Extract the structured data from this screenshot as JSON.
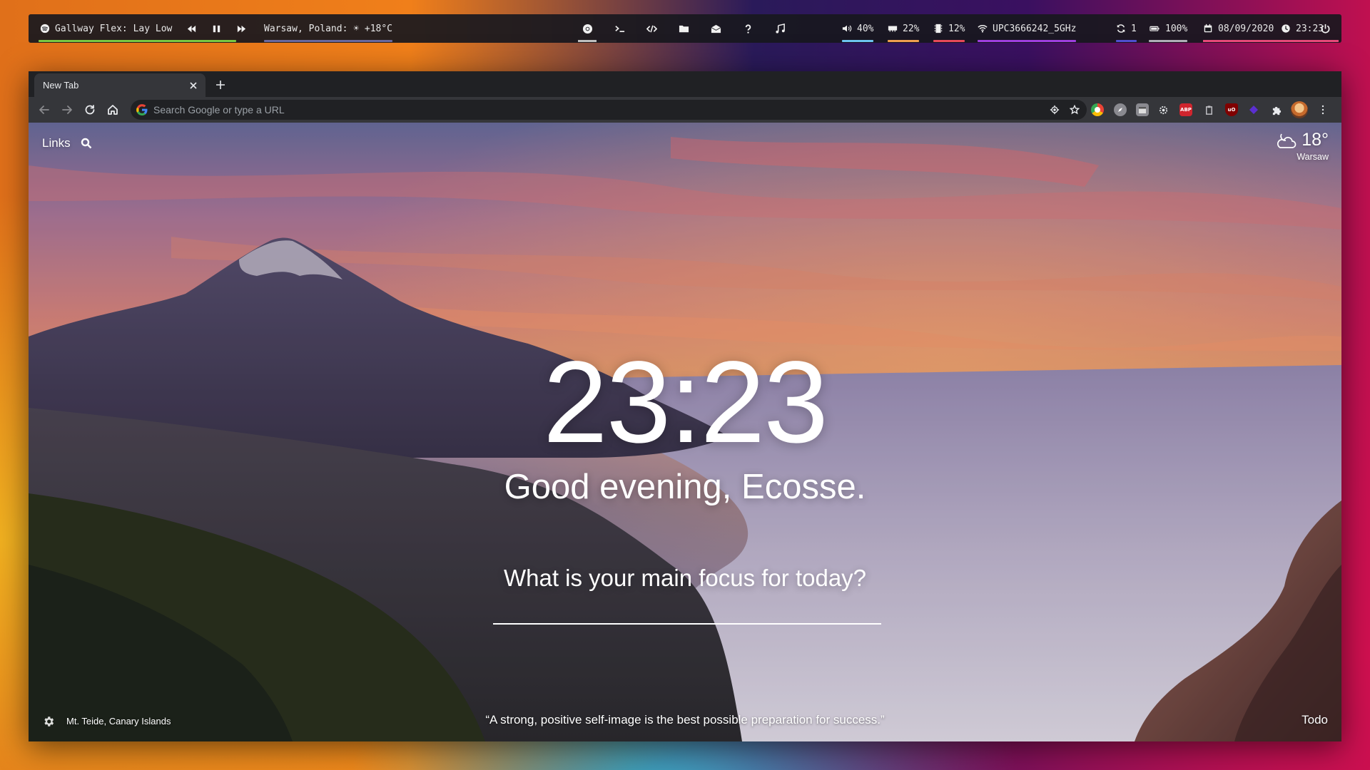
{
  "topbar": {
    "media": {
      "track": "Gallway Flex: Lay Low",
      "icon": "spotify-icon",
      "underline": "#7ac943"
    },
    "media_controls": [
      "previous-icon",
      "pause-icon",
      "next-icon"
    ],
    "weather": {
      "text": "Warsaw, Poland: ☀ +18°C",
      "underline": "#6a6aa0"
    },
    "launchers": [
      {
        "name": "chrome-launcher",
        "icon": "chrome-icon",
        "underline": "#c0c0c0"
      },
      {
        "name": "terminal-launcher",
        "icon": "terminal-icon"
      },
      {
        "name": "code-launcher",
        "icon": "code-icon"
      },
      {
        "name": "files-launcher",
        "icon": "folder-icon"
      },
      {
        "name": "mail-launcher",
        "icon": "mail-icon"
      },
      {
        "name": "help-launcher",
        "icon": "question-icon"
      },
      {
        "name": "music-launcher",
        "icon": "music-note-icon"
      }
    ],
    "volume": {
      "value": "40%",
      "underline": "#6ec6f0"
    },
    "memory": {
      "value": "22%",
      "underline": "#f0a050"
    },
    "cpu": {
      "value": "12%",
      "underline": "#e84a5a"
    },
    "wifi": {
      "value": "UPC3666242_5GHz",
      "underline": "#a040e0"
    },
    "updates": {
      "value": "1",
      "underline": "#5050d0"
    },
    "battery": {
      "value": "100%",
      "underline": "#b0b0b8"
    },
    "date": {
      "value": "08/09/2020",
      "underline": "#e84a7a"
    },
    "time": {
      "value": "23:23",
      "underline": "#e84a7a"
    },
    "power": {
      "icon": "power-icon"
    }
  },
  "browser": {
    "tab": {
      "title": "New Tab"
    },
    "omnibox": {
      "placeholder": "Search Google or type a URL"
    },
    "extensions": [
      {
        "name": "ext-chrome-color",
        "label": "",
        "color": "#4285f4"
      },
      {
        "name": "ext-compass",
        "label": "",
        "color": "#7a7a80"
      },
      {
        "name": "ext-calendar",
        "label": "",
        "color": "#8a8a90"
      },
      {
        "name": "ext-settings-gear",
        "label": "",
        "color": "#5a5a60"
      },
      {
        "name": "ext-adblock-plus",
        "label": "ABP",
        "color": "#d0252e"
      },
      {
        "name": "ext-clipboard",
        "label": "",
        "color": "#5a5a60"
      },
      {
        "name": "ext-ublock-origin",
        "label": "uO",
        "color": "#800000"
      },
      {
        "name": "ext-purple-diamond",
        "label": "",
        "color": "#5b2fd0"
      },
      {
        "name": "ext-puzzle",
        "label": "",
        "color": "#35363a"
      }
    ]
  },
  "momentum": {
    "links_label": "Links",
    "weather_temp": "18°",
    "weather_location": "Warsaw",
    "clock": "23:23",
    "greeting": "Good evening, Ecosse.",
    "focus_question": "What is your main focus for today?",
    "focus_value": "",
    "photo_credit": "Mt. Teide, Canary Islands",
    "quote": "“A strong, positive self-image is the best possible preparation for success.”",
    "todo_label": "Todo"
  }
}
